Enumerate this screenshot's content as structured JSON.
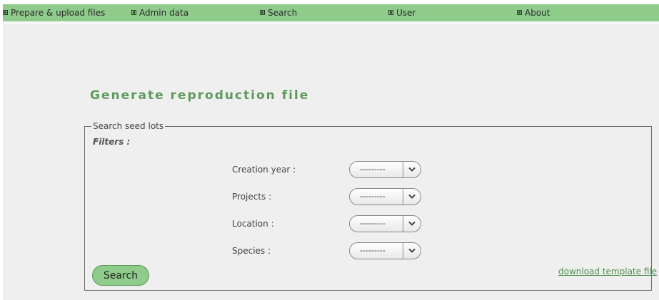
{
  "nav": {
    "items": [
      {
        "label": "Prepare & upload files"
      },
      {
        "label": "Admin data"
      },
      {
        "label": "Search"
      },
      {
        "label": "User"
      },
      {
        "label": "About"
      }
    ]
  },
  "page": {
    "title": "Generate reproduction file"
  },
  "search_panel": {
    "legend": "Search seed lots",
    "filters_label": "Filters :",
    "filters": [
      {
        "label": "Creation year :",
        "selected": "---------"
      },
      {
        "label": "Projects :",
        "selected": "---------"
      },
      {
        "label": "Location :",
        "selected": "---------"
      },
      {
        "label": "Species :",
        "selected": "---------"
      }
    ],
    "search_button": "Search",
    "template_link": "download template file"
  },
  "colors": {
    "nav_background": "#8fcc8c",
    "title": "#5d9a5a",
    "button": "#8fcc8c",
    "link": "#4e9150",
    "page_background": "#efefef"
  },
  "icons": {
    "nav_bullet": "square-bullet-icon",
    "select_arrow": "chevron-down-icon"
  }
}
